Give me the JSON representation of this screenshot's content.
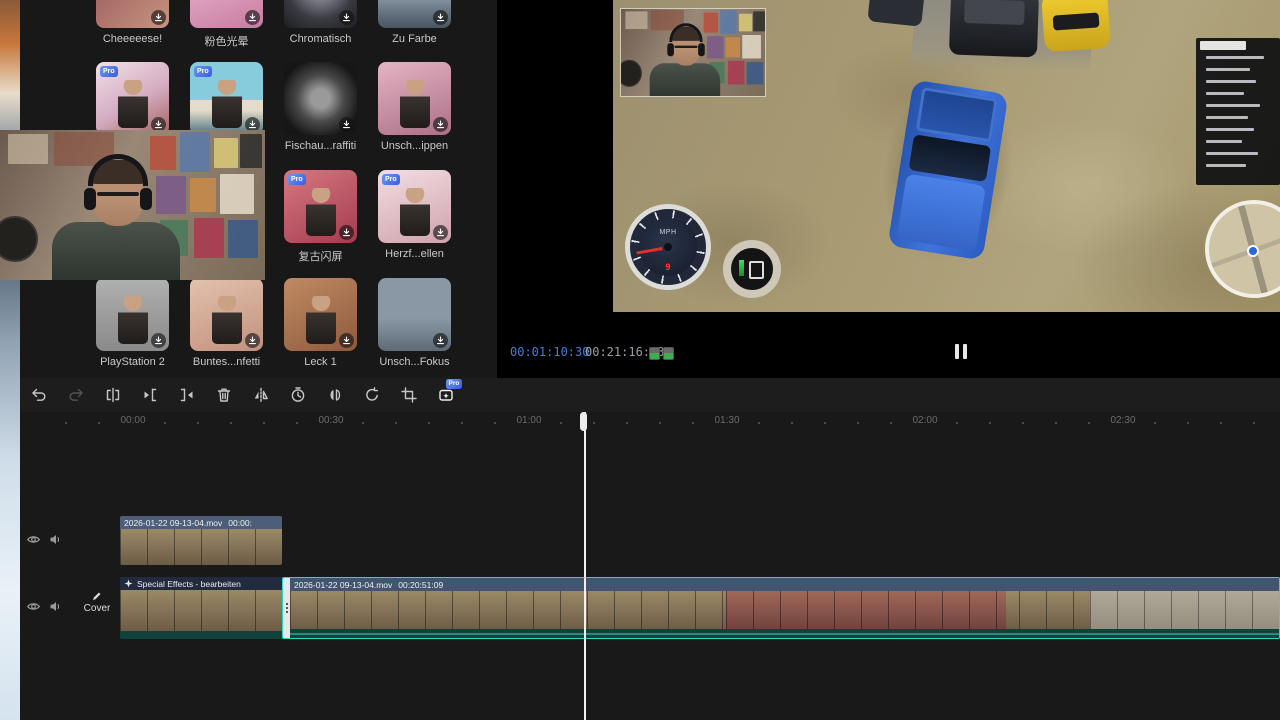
{
  "effects_panel": {
    "pro_badge": "Pro",
    "items": [
      {
        "label": "Cheeeeese!"
      },
      {
        "label": "粉色光晕"
      },
      {
        "label": "Chromatisch"
      },
      {
        "label": "Zu Farbe"
      },
      {
        "label": "Fischau...raffiti"
      },
      {
        "label": "Unsch...ippen"
      },
      {
        "label": "复古闪屏"
      },
      {
        "label": "Herzf...ellen"
      },
      {
        "label": "PlayStation 2"
      },
      {
        "label": "Buntes...nfetti"
      },
      {
        "label": "Leck 1"
      },
      {
        "label": "Unsch...Fokus"
      }
    ]
  },
  "preview": {
    "current_time": "00:01:10:30",
    "duration": "00:21:16:03",
    "hud": {
      "speed_unit": "MPH",
      "speed_value": "9"
    }
  },
  "toolbar": {
    "pro_badge": "Pro"
  },
  "timeline": {
    "ruler_labels": [
      "00:00",
      "00:30",
      "01:00",
      "01:30",
      "02:00",
      "02:30"
    ],
    "track1_clip": {
      "name": "2026-01-22 09-13-04.mov",
      "start": "00:00:"
    },
    "track2_effects_label": "Special Effects - bearbeiten",
    "track2_clip": {
      "name": "2026-01-22 09-13-04.mov",
      "start": "00:20:51:09"
    },
    "cover_label": "Cover"
  }
}
